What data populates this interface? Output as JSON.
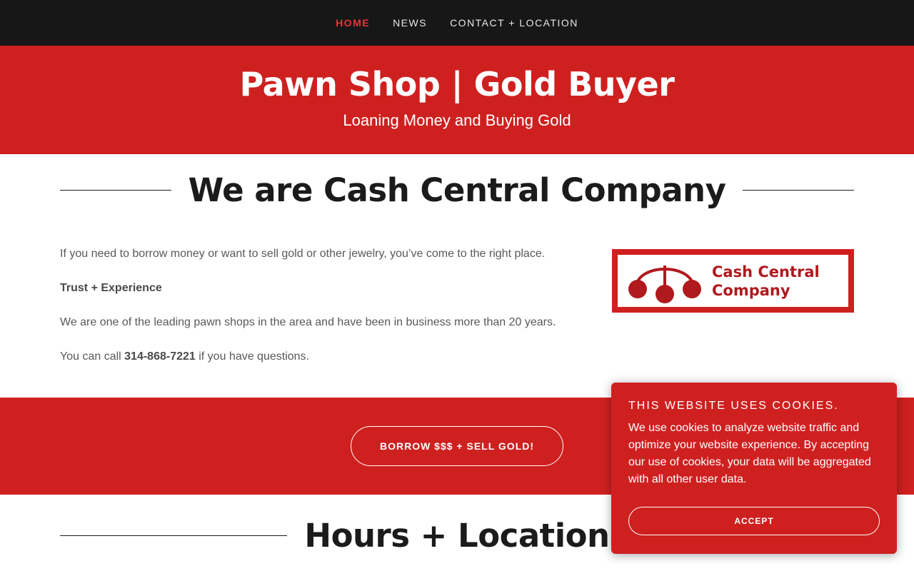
{
  "nav": {
    "items": [
      {
        "label": "HOME",
        "active": true
      },
      {
        "label": "NEWS",
        "active": false
      },
      {
        "label": "CONTACT + LOCATION",
        "active": false
      }
    ]
  },
  "hero": {
    "title": "Pawn Shop | Gold Buyer",
    "subtitle": "Loaning Money and Buying Gold"
  },
  "about": {
    "heading": "We are Cash Central Company",
    "paragraph1": "If you need to borrow money or want to sell gold or other jewelry, you’ve come to the right place.",
    "subheading": "Trust + Experience",
    "paragraph2": "We are one of the leading pawn shops in the area and have been in business more than 20 years.",
    "call_prefix": "You can call ",
    "phone": "314-868-7221",
    "call_suffix": " if you have questions.",
    "logo_line1": "Cash Central",
    "logo_line2": "Company"
  },
  "cta": {
    "button_label": "BORROW $$$ + SELL GOLD!"
  },
  "hours": {
    "heading": "Hours + Location"
  },
  "cookie_banner": {
    "title": "THIS WEBSITE USES COOKIES.",
    "body": "We use cookies to analyze website traffic and optimize your website experience. By accepting our use of cookies, your data will be aggregated with all other user data.",
    "accept_label": "ACCEPT"
  },
  "colors": {
    "brand_red": "#cf2020",
    "nav_bg": "#171717",
    "active_nav": "#e5343a"
  }
}
